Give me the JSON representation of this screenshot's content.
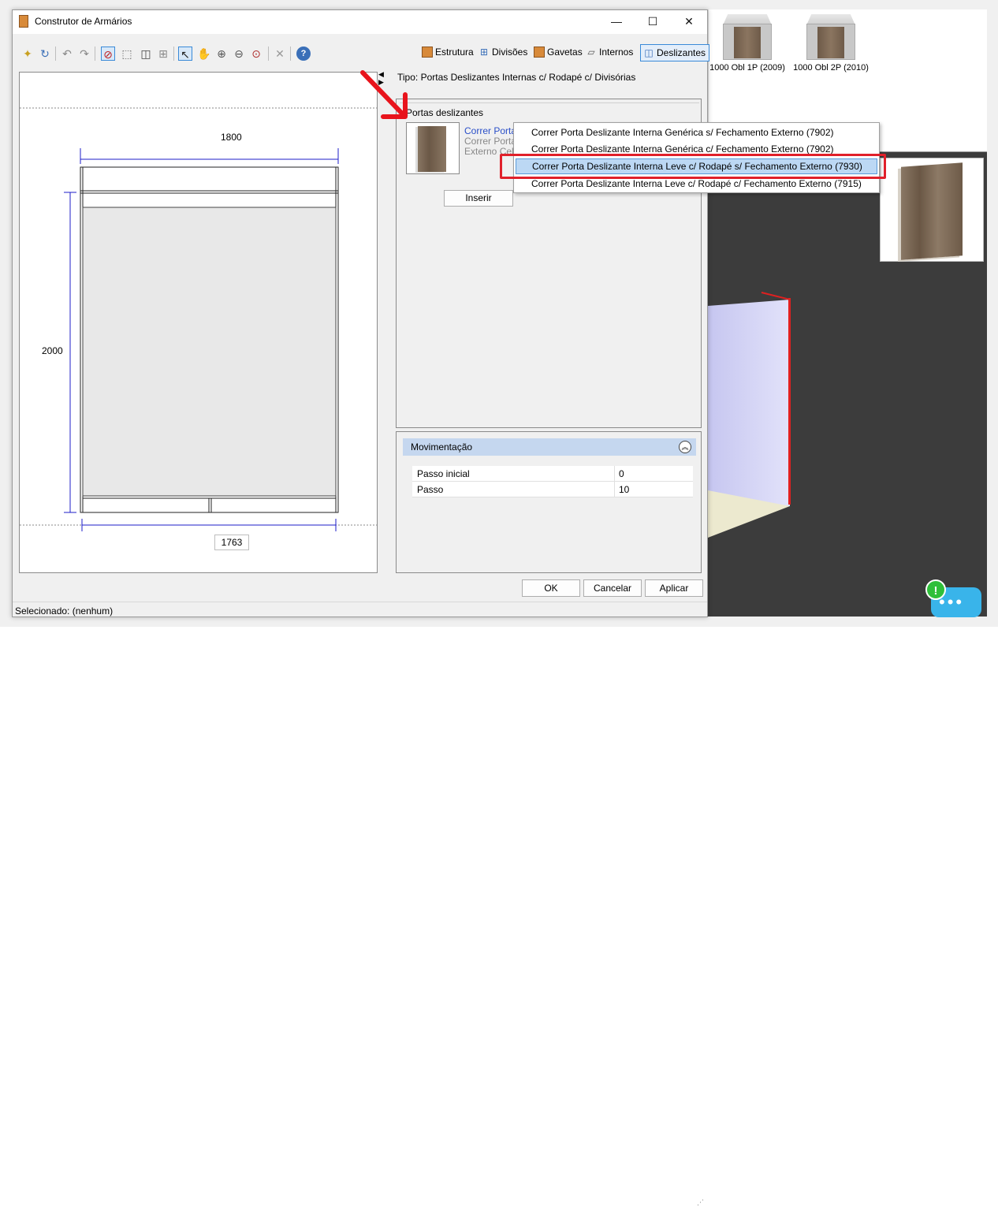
{
  "window": {
    "title": "Construtor de Armários",
    "minimize": "—",
    "maximize": "☐",
    "close": "✕"
  },
  "toolbar_tabs": [
    {
      "label": "Estrutura",
      "icon": "cabinet-icon"
    },
    {
      "label": "Divisões",
      "icon": "grid-icon"
    },
    {
      "label": "Gavetas",
      "icon": "drawer-icon"
    },
    {
      "label": "Internos",
      "icon": "shelves-icon"
    },
    {
      "label": "Deslizantes",
      "icon": "sliding-doors-icon"
    }
  ],
  "drawing": {
    "width_top": "1800",
    "height": "2000",
    "width_bottom": "1763"
  },
  "tipo": "Tipo: Portas Deslizantes Internas c/ Rodapé c/ Divisórias",
  "portas": {
    "group_title": "Portas deslizantes",
    "item_line1": "Correr Porta Deslizante Interna Leve c/ Rodapé",
    "item_line2": "Correr Porta Deslizante Interna Leve c/ Rodapé s/ Fechamento",
    "item_line3": "Externo Cel",
    "insert_label": "Inserir"
  },
  "dropdown": {
    "items": [
      "Correr Porta Deslizante Interna Genérica s/ Fechamento Externo (7902)",
      "Correr Porta Deslizante Interna Genérica c/ Fechamento Externo (7902)",
      "Correr Porta Deslizante Interna Leve c/ Rodapé s/ Fechamento Externo (7930)",
      "Correr Porta Deslizante Interna Leve c/ Rodapé c/ Fechamento Externo (7915)"
    ],
    "selected_index": 2
  },
  "movimentacao": {
    "title": "Movimentação",
    "rows": [
      {
        "name": "Passo inicial",
        "value": "0"
      },
      {
        "name": "Passo",
        "value": "10"
      }
    ]
  },
  "buttons": {
    "ok": "OK",
    "cancel": "Cancelar",
    "apply": "Aplicar"
  },
  "status": "Selecionado: (nenhum)",
  "catalog": {
    "items": [
      "1000 Obl 1P (2009)",
      "1000 Obl 2P (2010)"
    ]
  },
  "chat": {
    "badge": "!",
    "dots": "•••"
  },
  "colors": {
    "accent": "#3a8ad8",
    "highlight": "#e0202a",
    "dimension_line": "#1c1cc8"
  }
}
